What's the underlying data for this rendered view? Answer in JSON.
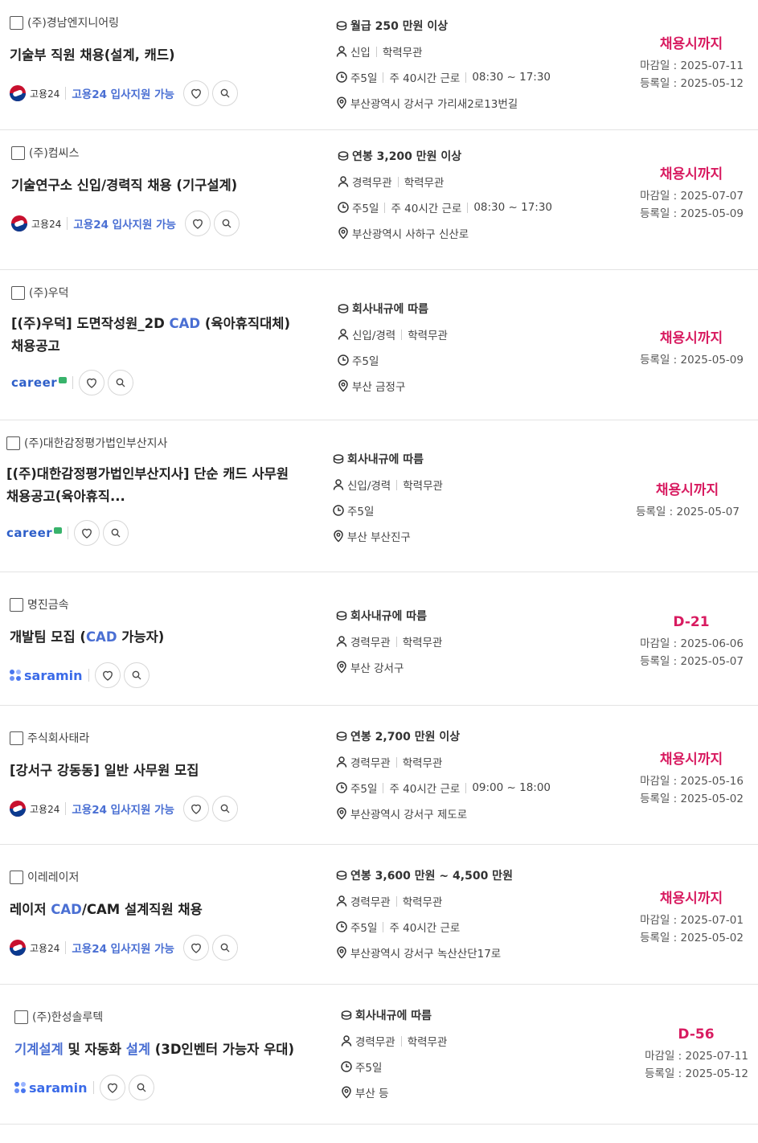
{
  "colors": {
    "accent": "#d81b60",
    "link": "#4a6fd3",
    "text": "#222222",
    "divider": "#e3e3e3"
  },
  "labels": {
    "deadline_prefix": "마감일 : ",
    "posted_prefix": "등록일 : "
  },
  "sources": {
    "work24": {
      "name": "고용24",
      "support": "고용24 입사지원 가능",
      "icon": "korea-gov-emblem-icon"
    },
    "career": {
      "name": "career"
    },
    "saramin": {
      "name": "saramin"
    }
  },
  "jobs": [
    {
      "company": "(주)경남엔지니어링",
      "title_parts": [
        "기술부 직원 채용(설계, 캐드)"
      ],
      "source": "work24",
      "salary": "월급 250 만원 이상",
      "experience": "신입",
      "education": "학력무관",
      "schedule": [
        "주5일",
        "주 40시간 근로",
        "08:30 ~ 17:30"
      ],
      "location": "부산광역시 강서구 가리새2로13번길",
      "status": "채용시까지",
      "deadline": "2025-07-11",
      "posted": "2025-05-12"
    },
    {
      "company": "(주)컴씨스",
      "title_parts": [
        "기술연구소 신입/경력직 채용 (기구설계)"
      ],
      "source": "work24",
      "salary": "연봉 3,200 만원 이상",
      "experience": "경력무관",
      "education": "학력무관",
      "schedule": [
        "주5일",
        "주 40시간 근로",
        "08:30 ~ 17:30"
      ],
      "location": "부산광역시 사하구 신산로",
      "status": "채용시까지",
      "deadline": "2025-07-07",
      "posted": "2025-05-09"
    },
    {
      "company": "(주)우덕",
      "title_line1_a": "[(주)우덕] 도면작성원_2D ",
      "title_line1_hl": "CAD",
      "title_line1_b": " (육아휴직대체)",
      "title_line2": "채용공고",
      "source": "career",
      "salary": "회사내규에 따름",
      "experience": "신입/경력",
      "education": "학력무관",
      "schedule": [
        "주5일"
      ],
      "location": "부산 금정구",
      "status": "채용시까지",
      "posted": "2025-05-09"
    },
    {
      "company": "(주)대한감정평가법인부산지사",
      "title_line1": "[(주)대한감정평가법인부산지사] 단순 캐드 사무원",
      "title_line2": "채용공고(육아휴직...",
      "source": "career",
      "salary": "회사내규에 따름",
      "experience": "신입/경력",
      "education": "학력무관",
      "schedule": [
        "주5일"
      ],
      "location": "부산 부산진구",
      "status": "채용시까지",
      "posted": "2025-05-07"
    },
    {
      "company": "명진금속",
      "title_a": "개발팀 모집 (",
      "title_hl": "CAD",
      "title_b": " 가능자)",
      "source": "saramin",
      "salary": "회사내규에 따름",
      "experience": "경력무관",
      "education": "학력무관",
      "location": "부산 강서구",
      "status": "D-21",
      "deadline": "2025-06-06",
      "posted": "2025-05-07"
    },
    {
      "company": "주식회사태라",
      "title_parts": [
        "[강서구 강동동] 일반 사무원 모집"
      ],
      "source": "work24",
      "salary": "연봉 2,700 만원 이상",
      "experience": "경력무관",
      "education": "학력무관",
      "schedule": [
        "주5일",
        "주 40시간 근로",
        "09:00 ~ 18:00"
      ],
      "location": "부산광역시 강서구 제도로",
      "status": "채용시까지",
      "deadline": "2025-05-16",
      "posted": "2025-05-02"
    },
    {
      "company": "이레레이저",
      "title_a": "레이저 ",
      "title_hl": "CAD",
      "title_b": "/CAM 설계직원 채용",
      "source": "work24",
      "salary": "연봉 3,600 만원 ~ 4,500 만원",
      "experience": "경력무관",
      "education": "학력무관",
      "schedule": [
        "주5일",
        "주 40시간 근로"
      ],
      "location": "부산광역시 강서구 녹산산단17로",
      "status": "채용시까지",
      "deadline": "2025-07-01",
      "posted": "2025-05-02"
    },
    {
      "company": "(주)한성솔루텍",
      "title_hl1": "기계설계",
      "title_mid": " 및 자동화 ",
      "title_hl2": "설계",
      "title_end": " (3D인벤터 가능자 우대)",
      "source": "saramin",
      "salary": "회사내규에 따름",
      "experience": "경력무관",
      "education": "학력무관",
      "schedule": [
        "주5일"
      ],
      "location": "부산 등",
      "status": "D-56",
      "deadline": "2025-07-11",
      "posted": "2025-05-12"
    }
  ]
}
